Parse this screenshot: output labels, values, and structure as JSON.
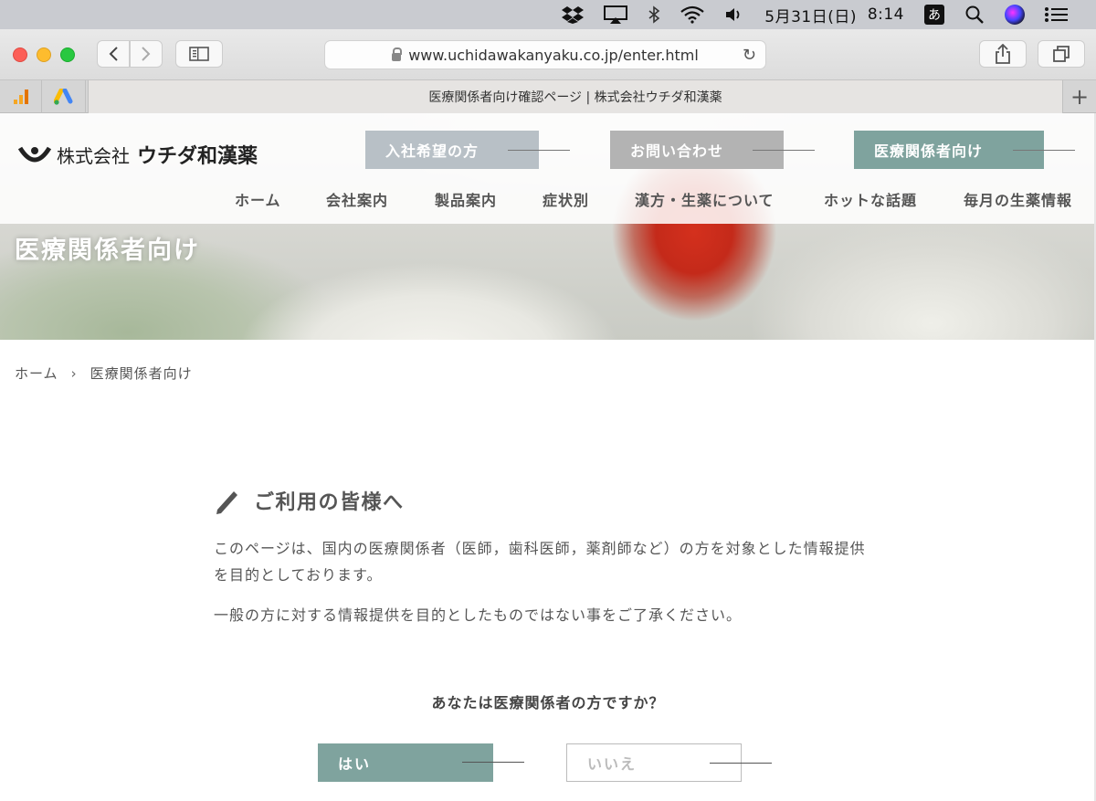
{
  "menubar": {
    "date": "5月31日(日)",
    "time": "8:14",
    "ime": "あ"
  },
  "browser": {
    "url": "www.uchidawakanyaku.co.jp/enter.html",
    "tab_title": "医療関係者向け確認ページ | 株式会社ウチダ和漢薬"
  },
  "site": {
    "logo_prefix": "株式会社",
    "logo_name": "ウチダ和漢薬",
    "top_buttons": [
      "入社希望の方",
      "お問い合わせ",
      "医療関係者向け"
    ],
    "nav": [
      "ホーム",
      "会社案内",
      "製品案内",
      "症状別",
      "漢方・生薬について",
      "ホットな話題",
      "毎月の生薬情報"
    ],
    "hero_title": "医療関係者向け"
  },
  "breadcrumb": {
    "home": "ホーム",
    "sep": "›",
    "current": "医療関係者向け"
  },
  "content": {
    "title": "ご利用の皆様へ",
    "para1": "このページは、国内の医療関係者（医師，歯科医師，薬剤師など）の方を対象とした情報提供を目的としております。",
    "para2": "一般の方に対する情報提供を目的としたものではない事をご了承ください。",
    "question": "あなたは医療関係者の方ですか？",
    "yes_label": "はい",
    "no_label": "いいえ"
  },
  "colors": {
    "accent": "#7fa39e",
    "button_grey1": "#b8c0c6",
    "button_grey2": "#b3b3b3"
  }
}
